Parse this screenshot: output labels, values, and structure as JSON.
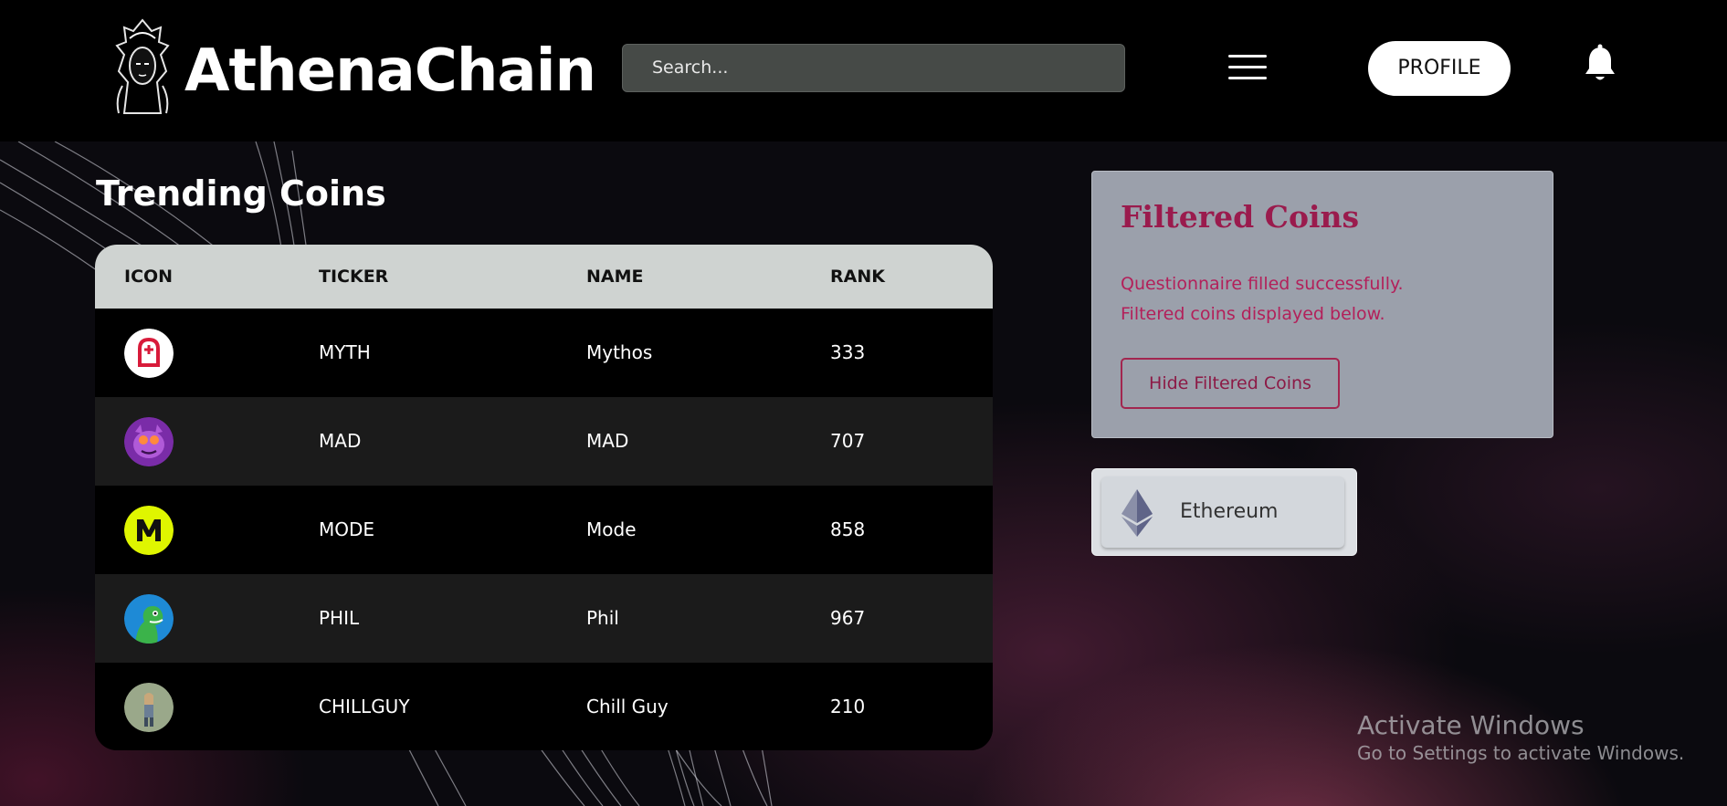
{
  "header": {
    "brand": "AthenaChain",
    "search_placeholder": "Search...",
    "profile_label": "PROFILE"
  },
  "main": {
    "title": "Trending Coins",
    "columns": [
      "ICON",
      "TICKER",
      "NAME",
      "RANK"
    ],
    "rows": [
      {
        "icon": "mythos-coin-icon",
        "ticker": "MYTH",
        "name": "Mythos",
        "rank": "333"
      },
      {
        "icon": "mad-coin-icon",
        "ticker": "MAD",
        "name": "MAD",
        "rank": "707"
      },
      {
        "icon": "mode-coin-icon",
        "ticker": "MODE",
        "name": "Mode",
        "rank": "858"
      },
      {
        "icon": "phil-coin-icon",
        "ticker": "PHIL",
        "name": "Phil",
        "rank": "967"
      },
      {
        "icon": "chillguy-coin-icon",
        "ticker": "CHILLGUY",
        "name": "Chill Guy",
        "rank": "210"
      }
    ]
  },
  "filtered": {
    "title": "Filtered Coins",
    "message_line1": "Questionnaire filled successfully.",
    "message_line2": "Filtered coins displayed below.",
    "hide_button": "Hide Filtered Coins",
    "coins": [
      {
        "icon": "ethereum-icon",
        "name": "Ethereum"
      }
    ]
  },
  "watermark": {
    "line1": "Activate Windows",
    "line2": "Go to Settings to activate Windows."
  },
  "colors": {
    "header_bg": "#000000",
    "accent": "#9a1b4d",
    "table_header_bg": "#cfd3d1",
    "filtered_panel_bg": "#9ba0ab"
  }
}
